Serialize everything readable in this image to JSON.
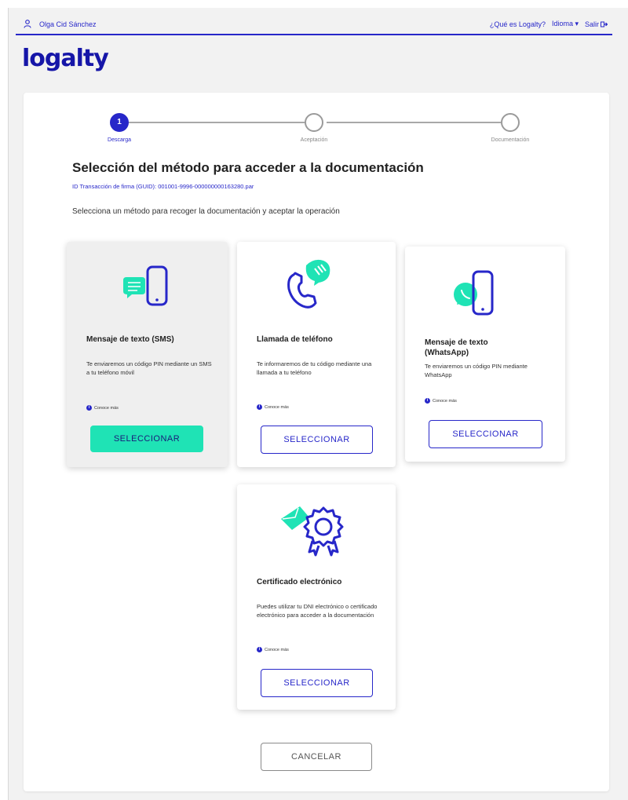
{
  "header": {
    "user_name": "Olga Cid Sánchez",
    "nav": {
      "about": "¿Qué es Logalty?",
      "language": "Idioma ▾",
      "logout": "Salir"
    }
  },
  "brand": {
    "logo": "logalty"
  },
  "stepper": {
    "steps": [
      {
        "number": "1",
        "label": "Descarga"
      },
      {
        "number": "",
        "label": "Aceptación"
      },
      {
        "number": "",
        "label": "Documentación"
      }
    ]
  },
  "main": {
    "title": "Selección del método para acceder a la documentación",
    "guid": "ID Transacción de firma (GUID): 001001-9996-000000000163280.par",
    "instructions": "Selecciona un método para recoger la documentación y aceptar la operación"
  },
  "methods": [
    {
      "title": "Mensaje de texto (SMS)",
      "description": "Te enviaremos un código PIN mediante un SMS a tu teléfono móvil",
      "more": "Conoce más",
      "button": "SELECCIONAR"
    },
    {
      "title": "Llamada de teléfono",
      "description": "Te informaremos de tu código mediante una llamada a tu teléfono",
      "more": "Conoce más",
      "button": "SELECCIONAR"
    },
    {
      "title": "Mensaje de texto (WhatsApp)",
      "description": "Te enviaremos un código PIN mediante WhatsApp",
      "more": "Conoce más",
      "button": "SELECCIONAR"
    },
    {
      "title": "Certificado electrónico",
      "description": "Puedes utilizar tu DNI electrónico o certificado electrónico para acceder a la documentación",
      "more": "Conoce más",
      "button": "SELECCIONAR"
    }
  ],
  "footer": {
    "cancel": "CANCELAR"
  },
  "colors": {
    "primary": "#2727c9",
    "accent": "#1fe3b5",
    "background": "#f2f2f2"
  },
  "icons": [
    "user-icon",
    "logout-icon",
    "info-icon",
    "sms-phone-icon",
    "phone-call-icon",
    "whatsapp-phone-icon",
    "certificate-icon"
  ]
}
